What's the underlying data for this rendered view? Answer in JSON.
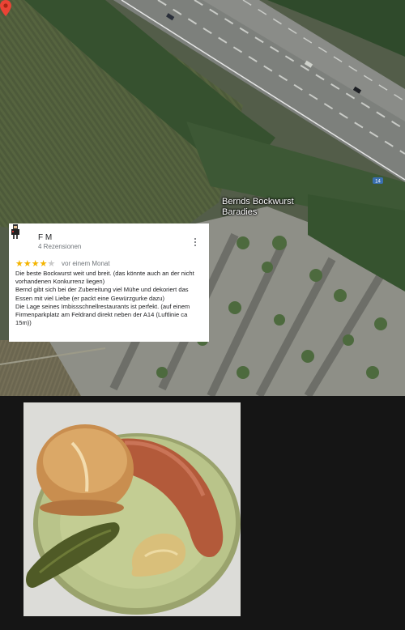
{
  "map": {
    "place_label": "Bernds Bockwurst\nBaradies",
    "road_shield": "14",
    "icons": [
      "map-pin-icon"
    ]
  },
  "review": {
    "author": "F M",
    "reviews_count": "4 Rezensionen",
    "rating": 4,
    "max_rating": 5,
    "time_ago": "vor einem Monat",
    "text_lines": [
      "Die beste Bockwurst weit und breit. (das könnte auch an der nicht vorhandenen Konkurrenz liegen)",
      "Bernd gibt sich bei der Zubereitung viel Mühe und dekoriert das Essen mit viel Liebe (er packt eine Gewürzgurke dazu)",
      "Die Lage seines Imbissschnellrestaurants ist perfekt. (auf einem Firmenparkplatz am Feldrand direkt neben der A14 (Luftlinie ca 15m))"
    ],
    "icons": [
      "avatar-icon",
      "more-vert-icon",
      "star-icon"
    ]
  },
  "photo": {
    "subject": "bockwurst-plate",
    "colors": {
      "plate": "#b9c48a",
      "sausage": "#b35a3a",
      "bun": "#c98e4f",
      "pickle": "#4f5a26",
      "mustard": "#d9bf7a"
    }
  },
  "colors": {
    "accent_star": "#f4b400",
    "pin_red": "#ea4335",
    "background": "#161616"
  }
}
